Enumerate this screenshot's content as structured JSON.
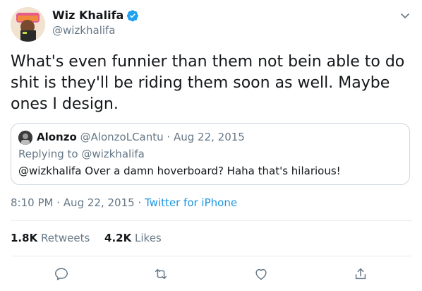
{
  "author": {
    "name": "Wiz Khalifa",
    "handle": "@wizkhalifa",
    "verified_icon": "verified-badge-icon"
  },
  "tweet": {
    "text": "What's even funnier than them not bein able to do shit is they'll be riding them soon as well. Maybe ones I design."
  },
  "quoted": {
    "name": "Alonzo",
    "handle": "@AlonzoLCantu",
    "separator": "·",
    "date": "Aug 22, 2015",
    "replying_prefix": "Replying to",
    "replying_handle": "@wizkhalifa",
    "text": "@wizkhalifa Over a damn hoverboard? Haha that's hilarious!"
  },
  "meta": {
    "time": "8:10 PM",
    "separator": "·",
    "date": "Aug 22, 2015",
    "source": "Twitter for iPhone"
  },
  "stats": {
    "retweets_count": "1.8K",
    "retweets_label": "Retweets",
    "likes_count": "4.2K",
    "likes_label": "Likes"
  },
  "actions": [
    "reply-icon",
    "retweet-icon",
    "like-icon",
    "share-icon"
  ],
  "colors": {
    "accent": "#1b95e0",
    "verified": "#1da1f2",
    "secondary_text": "#657786",
    "divider": "#e6ecf0"
  }
}
